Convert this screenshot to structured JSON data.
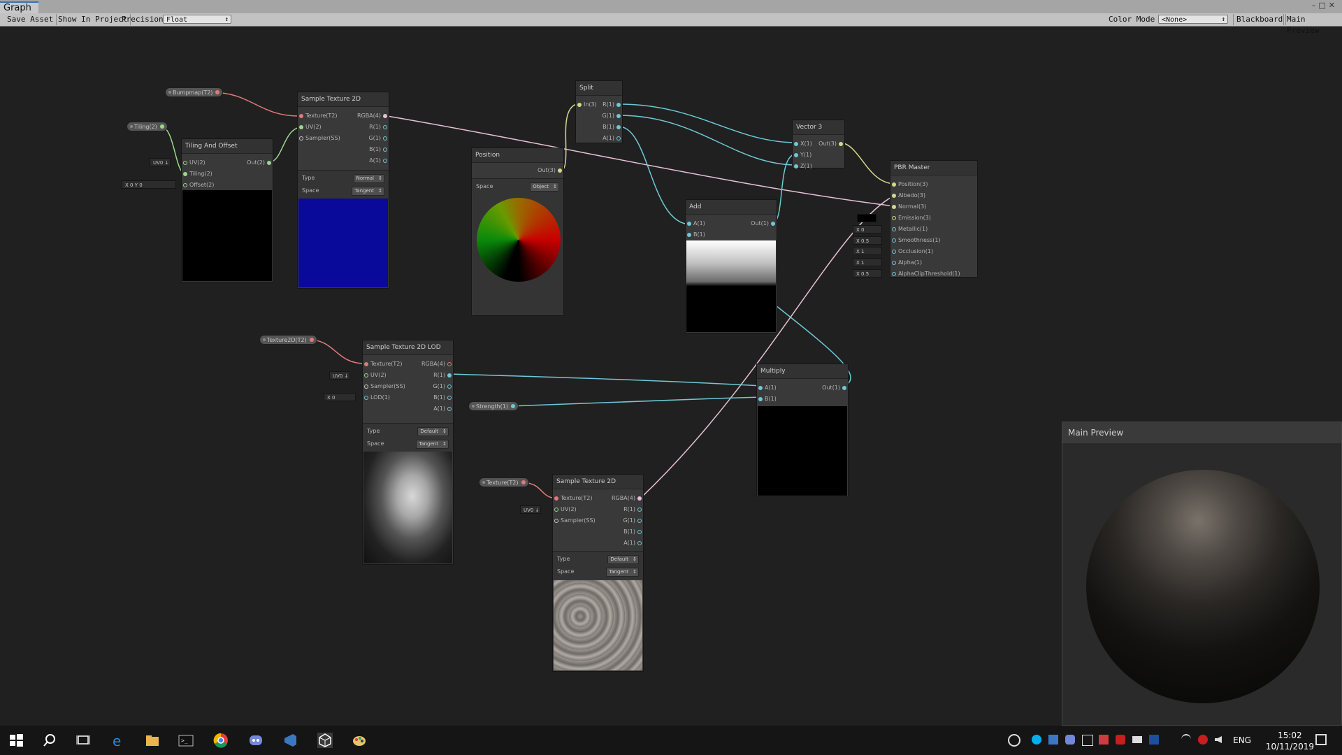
{
  "window": {
    "tab_title": "Graph",
    "controls": "–□✕"
  },
  "toolbar": {
    "save_asset": "Save Asset",
    "show_in_project": "Show In Project",
    "precision_label": "Precision",
    "precision_value": "Float",
    "color_mode_label": "Color Mode",
    "color_mode_value": "<None>",
    "blackboard": "Blackboard",
    "main_preview": "Main Preview"
  },
  "colors": {
    "background": "#202020",
    "wire_texture": "#e07a7a",
    "wire_vector": "#d4d88a",
    "wire_float": "#6ec9d4",
    "wire_vector2": "#9ad88a"
  },
  "properties": {
    "bumpmap": "Bumpmap(T2)",
    "tiling": "Tiling(2)",
    "texture2d_t2": "Texture2D(T2)",
    "strength": "Strength(1)",
    "texture_t2": "Texture(T2)"
  },
  "inputs": {
    "uv0": "UV0 ↓",
    "offset": "X 0   Y 0",
    "lod": "X 0",
    "emission_swatch": "",
    "metallic": "X  0",
    "smoothness": "X  0.5",
    "occlusion": "X  1",
    "alpha": "X  1",
    "clip": "X  0.5"
  },
  "nodes": {
    "sample_tex_1": {
      "title": "Sample Texture 2D",
      "inputs": [
        "Texture(T2)",
        "UV(2)",
        "Sampler(SS)"
      ],
      "outputs": [
        "RGBA(4)",
        "R(1)",
        "G(1)",
        "B(1)",
        "A(1)"
      ],
      "type_label": "Type",
      "type_value": "Normal",
      "space_label": "Space",
      "space_value": "Tangent"
    },
    "tiling_offset": {
      "title": "Tiling And Offset",
      "inputs": [
        "UV(2)",
        "Tiling(2)",
        "Offset(2)"
      ],
      "outputs": [
        "Out(2)"
      ]
    },
    "split": {
      "title": "Split",
      "inputs": [
        "In(3)"
      ],
      "outputs": [
        "R(1)",
        "G(1)",
        "B(1)",
        "A(1)"
      ]
    },
    "position": {
      "title": "Position",
      "outputs": [
        "Out(3)"
      ],
      "space_label": "Space",
      "space_value": "Object"
    },
    "vector3": {
      "title": "Vector 3",
      "inputs": [
        "X(1)",
        "Y(1)",
        "Z(1)"
      ],
      "outputs": [
        "Out(3)"
      ]
    },
    "add": {
      "title": "Add",
      "inputs": [
        "A(1)",
        "B(1)"
      ],
      "outputs": [
        "Out(1)"
      ]
    },
    "pbr_master": {
      "title": "PBR Master",
      "inputs": [
        "Position(3)",
        "Albedo(3)",
        "Normal(3)",
        "Emission(3)",
        "Metallic(1)",
        "Smoothness(1)",
        "Occlusion(1)",
        "Alpha(1)",
        "AlphaClipThreshold(1)"
      ]
    },
    "sample_tex_lod": {
      "title": "Sample Texture 2D LOD",
      "inputs": [
        "Texture(T2)",
        "UV(2)",
        "Sampler(SS)",
        "LOD(1)"
      ],
      "outputs": [
        "RGBA(4)",
        "R(1)",
        "G(1)",
        "B(1)",
        "A(1)"
      ],
      "type_label": "Type",
      "type_value": "Default",
      "space_label": "Space",
      "space_value": "Tangent"
    },
    "multiply": {
      "title": "Multiply",
      "inputs": [
        "A(1)",
        "B(1)"
      ],
      "outputs": [
        "Out(1)"
      ]
    },
    "sample_tex_2": {
      "title": "Sample Texture 2D",
      "inputs": [
        "Texture(T2)",
        "UV(2)",
        "Sampler(SS)"
      ],
      "outputs": [
        "RGBA(4)",
        "R(1)",
        "G(1)",
        "B(1)",
        "A(1)"
      ],
      "type_label": "Type",
      "type_value": "Default",
      "space_label": "Space",
      "space_value": "Tangent"
    }
  },
  "main_preview": {
    "title": "Main Preview"
  },
  "taskbar": {
    "icons": [
      "windows-start-icon",
      "search-icon",
      "task-view-icon",
      "edge-icon",
      "file-explorer-icon",
      "terminal-icon",
      "chrome-icon",
      "discord-icon",
      "visual-studio-icon",
      "unity-icon",
      "paint-icon"
    ],
    "language": "ENG",
    "time": "15:02",
    "date": "10/11/2019"
  }
}
